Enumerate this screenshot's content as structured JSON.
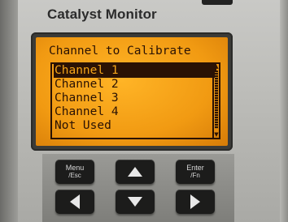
{
  "device": {
    "title": "Catalyst Monitor"
  },
  "screen": {
    "heading": "Channel to Calibrate",
    "items": [
      {
        "label": "Channel 1",
        "selected": true
      },
      {
        "label": "Channel 2",
        "selected": false
      },
      {
        "label": "Channel 3",
        "selected": false
      },
      {
        "label": "Channel 4",
        "selected": false
      },
      {
        "label": "Not Used",
        "selected": false
      }
    ],
    "colors": {
      "backlight": "#f19a12",
      "text": "#2a1204"
    }
  },
  "keypad": {
    "menu_label": "Menu",
    "esc_label": "/Esc",
    "enter_label": "Enter",
    "fn_label": "/Fn",
    "up_icon": "arrow-up-icon",
    "down_icon": "arrow-down-icon",
    "left_icon": "arrow-left-icon",
    "right_icon": "arrow-right-icon"
  }
}
